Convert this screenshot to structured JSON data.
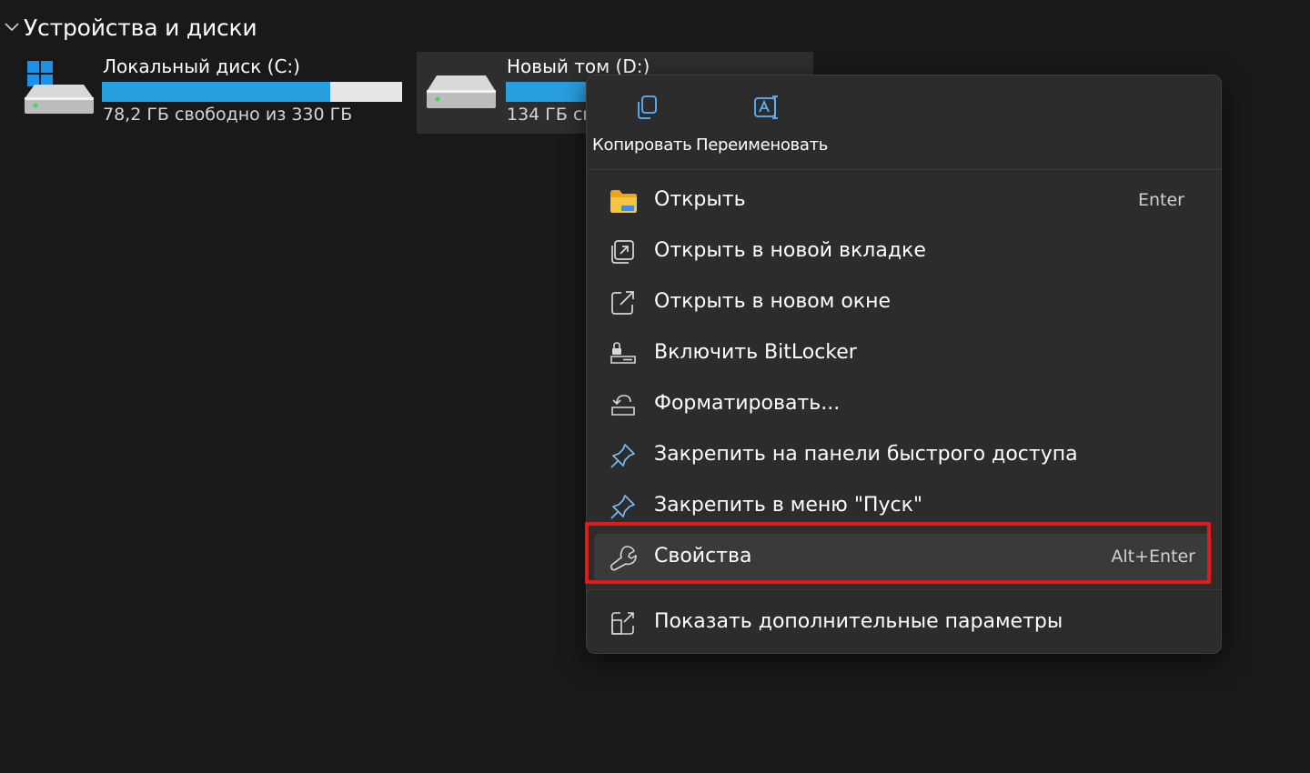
{
  "section": {
    "title": "Устройства и диски",
    "chevron_icon": "chevron-down-icon"
  },
  "drives": [
    {
      "name": "Локальный диск (C:)",
      "free_text": "78,2 ГБ свободно из 330 ГБ",
      "usage_fraction": 0.76,
      "icon": "windows-system-drive-icon"
    },
    {
      "name": "Новый том (D:)",
      "free_text": "134 ГБ св",
      "usage_fraction": 0.27,
      "icon": "hard-drive-icon",
      "selected": true
    }
  ],
  "context_menu": {
    "quick_actions": [
      {
        "label": "Копировать",
        "icon": "copy-icon"
      },
      {
        "label": "Переименовать",
        "icon": "rename-icon"
      }
    ],
    "items": [
      {
        "label": "Открыть",
        "shortcut": "Enter",
        "icon": "folder-icon"
      },
      {
        "label": "Открыть в новой вкладке",
        "shortcut": "",
        "icon": "new-tab-icon"
      },
      {
        "label": "Открыть в новом окне",
        "shortcut": "",
        "icon": "open-new-window-icon"
      },
      {
        "label": "Включить BitLocker",
        "shortcut": "",
        "icon": "bitlocker-icon"
      },
      {
        "label": "Форматировать...",
        "shortcut": "",
        "icon": "format-drive-icon"
      },
      {
        "label": "Закрепить на панели быстрого доступа",
        "shortcut": "",
        "icon": "pin-icon"
      },
      {
        "label": "Закрепить в меню \"Пуск\"",
        "shortcut": "",
        "icon": "pin-icon"
      },
      {
        "label": "Свойства",
        "shortcut": "Alt+Enter",
        "icon": "wrench-icon",
        "highlighted": true
      },
      {
        "label": "Показать дополнительные параметры",
        "shortcut": "",
        "icon": "more-options-icon"
      }
    ]
  },
  "colors": {
    "background": "#191919",
    "menu_background": "#2c2c2c",
    "bar_fill": "#2a9fe0",
    "bar_track": "#e6e6e6",
    "highlight_border": "#e01a1a",
    "folder_yellow": "#f4c542"
  }
}
